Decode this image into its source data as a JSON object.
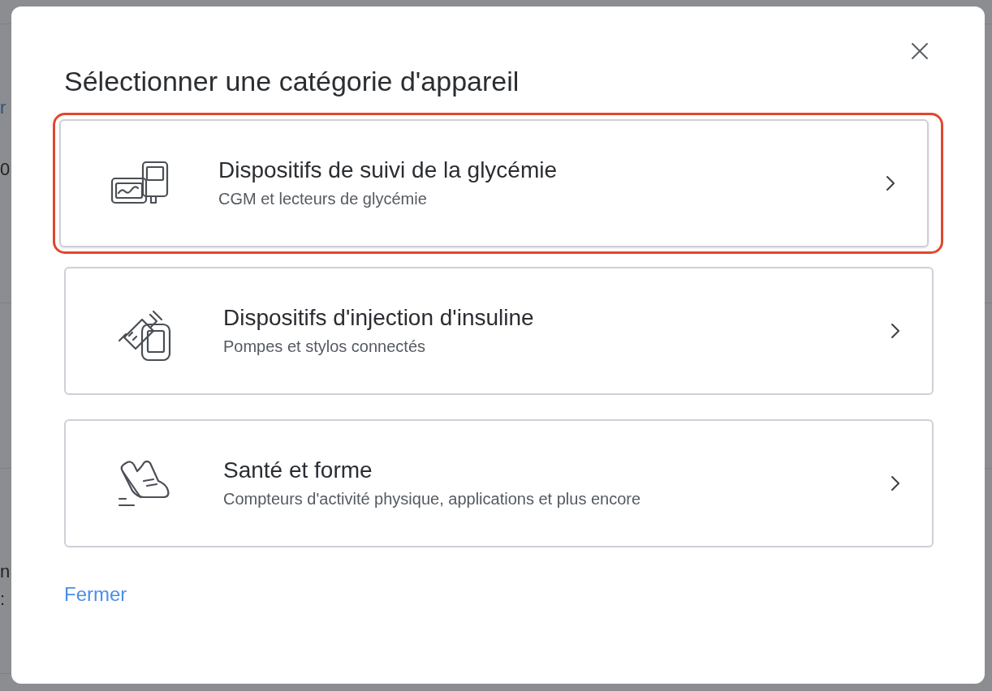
{
  "background_fragments": [
    {
      "text": "r",
      "kind": "link"
    },
    {
      "text": "0",
      "kind": "text"
    },
    {
      "text": "n",
      "kind": "text"
    },
    {
      "text": ":",
      "kind": "text"
    }
  ],
  "dialog": {
    "title": "Sélectionner une catégorie d'appareil",
    "categories": [
      {
        "kind": "glucose",
        "title": "Dispositifs de suivi de la glycémie",
        "subtitle": "CGM et lecteurs de glycémie",
        "selected": true
      },
      {
        "kind": "insulin",
        "title": "Dispositifs d'injection d'insuline",
        "subtitle": "Pompes et stylos connectés",
        "selected": false
      },
      {
        "kind": "fitness",
        "title": "Santé et forme",
        "subtitle": "Compteurs d'activité physique, applications et plus encore",
        "selected": false
      }
    ],
    "close_link": "Fermer"
  }
}
